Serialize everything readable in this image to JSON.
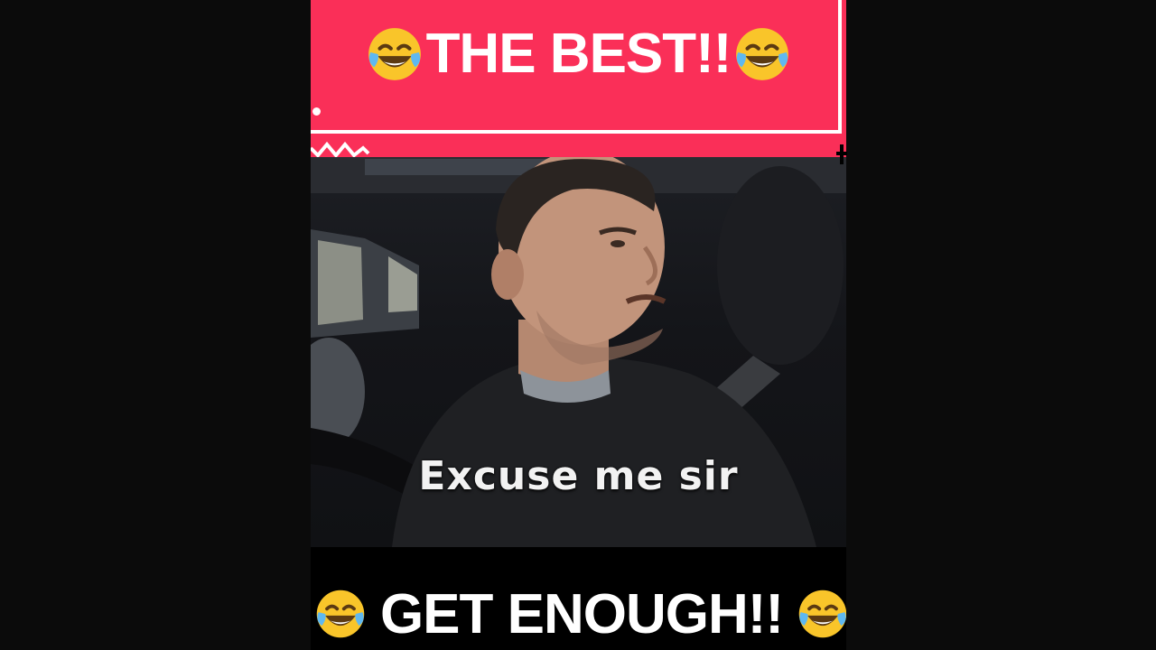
{
  "banner": {
    "title": "THE BEST!!",
    "background_color": "#fa2f58",
    "emoji_left": "face-with-tears-of-joy-icon",
    "emoji_right": "face-with-tears-of-joy-icon"
  },
  "video": {
    "subtitle": "Excuse me sir"
  },
  "bottom": {
    "text": "GET ENOUGH!!",
    "emoji_left": "face-with-tears-of-joy-icon",
    "emoji_right": "face-with-tears-of-joy-icon"
  }
}
